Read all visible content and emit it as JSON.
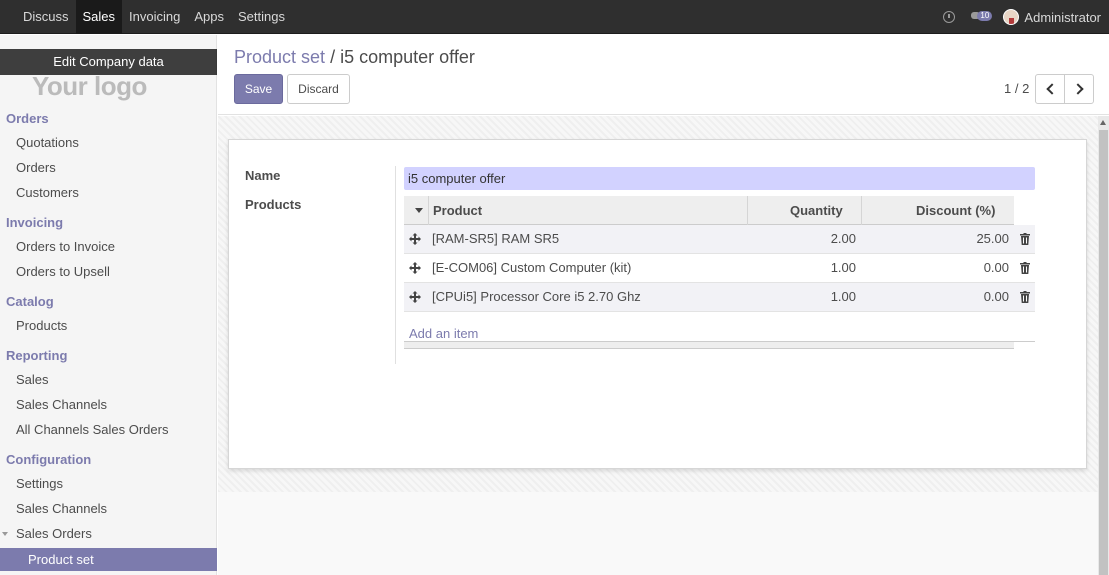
{
  "topbar": {
    "menu": [
      "Discuss",
      "Sales",
      "Invoicing",
      "Apps",
      "Settings"
    ],
    "active": "Sales",
    "notification_count": "10",
    "user": "Administrator"
  },
  "sidebar": {
    "logo_text": "Your logo",
    "edit_company": "Edit Company data",
    "sections": [
      {
        "title": "Orders",
        "items": [
          "Quotations",
          "Orders",
          "Customers"
        ]
      },
      {
        "title": "Invoicing",
        "items": [
          "Orders to Invoice",
          "Orders to Upsell"
        ]
      },
      {
        "title": "Catalog",
        "items": [
          "Products"
        ]
      },
      {
        "title": "Reporting",
        "items": [
          "Sales",
          "Sales Channels",
          "All Channels Sales Orders"
        ]
      },
      {
        "title": "Configuration",
        "items": [
          "Settings",
          "Sales Channels",
          "Sales Orders",
          "Product set"
        ]
      }
    ],
    "active_item": "Product set"
  },
  "control_panel": {
    "breadcrumb_parent": "Product set",
    "breadcrumb_sep": "/",
    "breadcrumb_current": "i5 computer offer",
    "save_label": "Save",
    "discard_label": "Discard",
    "pager": "1 / 2"
  },
  "form": {
    "name_label": "Name",
    "name_value": "i5 computer offer",
    "products_label": "Products",
    "columns": [
      "Product",
      "Quantity",
      "Discount (%)"
    ],
    "rows": [
      {
        "product": "[RAM-SR5] RAM SR5",
        "quantity": "2.00",
        "discount": "25.00"
      },
      {
        "product": "[E-COM06] Custom Computer (kit)",
        "quantity": "1.00",
        "discount": "0.00"
      },
      {
        "product": "[CPUi5] Processor Core i5 2.70 Ghz",
        "quantity": "1.00",
        "discount": "0.00"
      }
    ],
    "add_item_label": "Add an item"
  },
  "colors": {
    "accent": "#7c7bad",
    "topbar": "#2f2f2f",
    "name_field": "#d2d2ff"
  }
}
